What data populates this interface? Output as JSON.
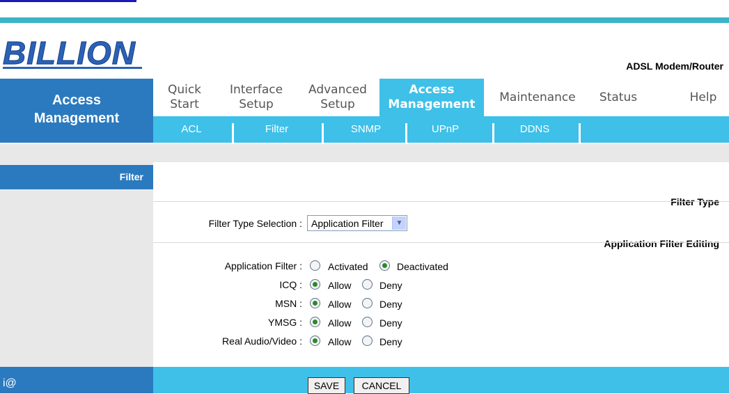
{
  "brand": {
    "logo": "BILLION",
    "product": "ADSL Modem/Router"
  },
  "sidebar": {
    "title_line1": "Access",
    "title_line2": "Management",
    "filter": "Filter",
    "filter_type": "Filter Type",
    "app_filter_editing": "Application Filter Editing"
  },
  "nav": {
    "tabs": [
      {
        "line1": "Quick",
        "line2": "Start"
      },
      {
        "line1": "Interface",
        "line2": "Setup"
      },
      {
        "line1": "Advanced",
        "line2": "Setup"
      },
      {
        "line1": "Access",
        "line2": "Management"
      },
      {
        "line1": "Maintenance",
        "line2": ""
      },
      {
        "line1": "Status",
        "line2": ""
      },
      {
        "line1": "Help",
        "line2": ""
      }
    ],
    "active": "Access Management"
  },
  "subnav": [
    "ACL",
    "Filter",
    "SNMP",
    "UPnP",
    "DDNS"
  ],
  "form": {
    "filter_type_label": "Filter Type Selection :",
    "filter_type_value": "Application Filter",
    "app_filter_label": "Application Filter :",
    "activated": "Activated",
    "deactivated": "Deactivated",
    "app_filter_state": "Deactivated",
    "rows": [
      {
        "label": "ICQ :",
        "value": "Allow"
      },
      {
        "label": "MSN :",
        "value": "Allow"
      },
      {
        "label": "YMSG :",
        "value": "Allow"
      },
      {
        "label": "Real Audio/Video :",
        "value": "Allow"
      }
    ],
    "allow": "Allow",
    "deny": "Deny"
  },
  "footer": {
    "symbol": "i@",
    "save": "SAVE",
    "cancel": "CANCEL"
  },
  "colors": {
    "nav_blue": "#2b7abf",
    "tab_cyan": "#3ec0e8",
    "panel_gray": "#e8e8e8",
    "top_teal": "#3cb4c8"
  }
}
